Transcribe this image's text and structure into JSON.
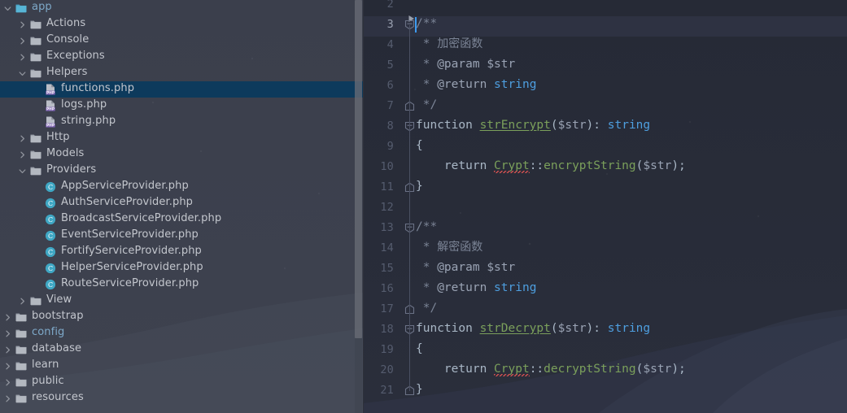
{
  "app": {
    "theme": "dark",
    "accent_selection": "#0d3a5c",
    "sidebar_bg": "#3b3f4c",
    "editor_bg": "#272b38"
  },
  "sidebar": {
    "name": "project-tree",
    "scrollbar": {
      "name": "sidebar-scrollbar"
    },
    "items": [
      {
        "label": "app",
        "depth": 0,
        "arrow": "down",
        "icon": "folder-module-icon",
        "color": "blue",
        "selected": false
      },
      {
        "label": "Actions",
        "depth": 1,
        "arrow": "right",
        "icon": "folder-icon",
        "color": "white",
        "selected": false
      },
      {
        "label": "Console",
        "depth": 1,
        "arrow": "right",
        "icon": "folder-icon",
        "color": "white",
        "selected": false
      },
      {
        "label": "Exceptions",
        "depth": 1,
        "arrow": "right",
        "icon": "folder-icon",
        "color": "white",
        "selected": false
      },
      {
        "label": "Helpers",
        "depth": 1,
        "arrow": "down",
        "icon": "folder-icon",
        "color": "white",
        "selected": false
      },
      {
        "label": "functions.php",
        "depth": 2,
        "arrow": "none",
        "icon": "php-file-icon",
        "color": "white",
        "selected": true
      },
      {
        "label": "logs.php",
        "depth": 2,
        "arrow": "none",
        "icon": "php-file-icon",
        "color": "white",
        "selected": false
      },
      {
        "label": "string.php",
        "depth": 2,
        "arrow": "none",
        "icon": "php-file-icon",
        "color": "white",
        "selected": false
      },
      {
        "label": "Http",
        "depth": 1,
        "arrow": "right",
        "icon": "folder-icon",
        "color": "white",
        "selected": false
      },
      {
        "label": "Models",
        "depth": 1,
        "arrow": "right",
        "icon": "folder-icon",
        "color": "white",
        "selected": false
      },
      {
        "label": "Providers",
        "depth": 1,
        "arrow": "down",
        "icon": "folder-icon",
        "color": "white",
        "selected": false
      },
      {
        "label": "AppServiceProvider.php",
        "depth": 2,
        "arrow": "none",
        "icon": "php-class-icon",
        "color": "white",
        "selected": false
      },
      {
        "label": "AuthServiceProvider.php",
        "depth": 2,
        "arrow": "none",
        "icon": "php-class-icon",
        "color": "white",
        "selected": false
      },
      {
        "label": "BroadcastServiceProvider.php",
        "depth": 2,
        "arrow": "none",
        "icon": "php-class-icon",
        "color": "white",
        "selected": false
      },
      {
        "label": "EventServiceProvider.php",
        "depth": 2,
        "arrow": "none",
        "icon": "php-class-icon",
        "color": "white",
        "selected": false
      },
      {
        "label": "FortifyServiceProvider.php",
        "depth": 2,
        "arrow": "none",
        "icon": "php-class-icon",
        "color": "white",
        "selected": false
      },
      {
        "label": "HelperServiceProvider.php",
        "depth": 2,
        "arrow": "none",
        "icon": "php-class-icon",
        "color": "white",
        "selected": false
      },
      {
        "label": "RouteServiceProvider.php",
        "depth": 2,
        "arrow": "none",
        "icon": "php-class-icon",
        "color": "white",
        "selected": false
      },
      {
        "label": "View",
        "depth": 1,
        "arrow": "right",
        "icon": "folder-icon",
        "color": "white",
        "selected": false
      },
      {
        "label": "bootstrap",
        "depth": 0,
        "arrow": "right",
        "icon": "folder-icon",
        "color": "white",
        "selected": false
      },
      {
        "label": "config",
        "depth": 0,
        "arrow": "right",
        "icon": "folder-icon",
        "color": "blue",
        "selected": false
      },
      {
        "label": "database",
        "depth": 0,
        "arrow": "right",
        "icon": "folder-icon",
        "color": "white",
        "selected": false
      },
      {
        "label": "learn",
        "depth": 0,
        "arrow": "right",
        "icon": "folder-icon",
        "color": "white",
        "selected": false
      },
      {
        "label": "public",
        "depth": 0,
        "arrow": "right",
        "icon": "folder-icon",
        "color": "white",
        "selected": false
      },
      {
        "label": "resources",
        "depth": 0,
        "arrow": "right",
        "icon": "folder-icon",
        "color": "white",
        "selected": false
      }
    ]
  },
  "editor": {
    "name": "code-editor",
    "language": "php",
    "caret": {
      "line": 3,
      "column": 1
    },
    "first_visible_line": 2,
    "lines": [
      {
        "n": 2,
        "indent": 0,
        "tokens": []
      },
      {
        "n": 3,
        "indent": 0,
        "fold": "expanded",
        "caret": true,
        "current": true,
        "run_marker": true,
        "tokens": [
          {
            "t": "/**",
            "c": "doc"
          }
        ]
      },
      {
        "n": 4,
        "indent": 0,
        "tokens": [
          {
            "t": " * ",
            "c": "doc"
          },
          {
            "t": "加密函数",
            "c": "cjk"
          }
        ]
      },
      {
        "n": 5,
        "indent": 0,
        "tokens": [
          {
            "t": " * ",
            "c": "doc"
          },
          {
            "t": "@param ",
            "c": "doctag"
          },
          {
            "t": "$str",
            "c": "doctag"
          }
        ]
      },
      {
        "n": 6,
        "indent": 0,
        "tokens": [
          {
            "t": " * ",
            "c": "doc"
          },
          {
            "t": "@return ",
            "c": "doctag"
          },
          {
            "t": "string",
            "c": "type"
          }
        ]
      },
      {
        "n": 7,
        "indent": 0,
        "fold": "end",
        "tokens": [
          {
            "t": " */",
            "c": "doc"
          }
        ]
      },
      {
        "n": 8,
        "indent": 0,
        "fold": "expanded",
        "tokens": [
          {
            "t": "function ",
            "c": "def"
          },
          {
            "t": "strEncrypt",
            "c": "fn-u"
          },
          {
            "t": "(",
            "c": "punct"
          },
          {
            "t": "$str",
            "c": "var"
          },
          {
            "t": ")",
            "c": "punct"
          },
          {
            "t": ": ",
            "c": "punct"
          },
          {
            "t": "string",
            "c": "type"
          }
        ]
      },
      {
        "n": 9,
        "indent": 0,
        "tokens": [
          {
            "t": "{",
            "c": "def"
          }
        ]
      },
      {
        "n": 10,
        "indent": 0,
        "tokens": [
          {
            "t": "    return ",
            "c": "def"
          },
          {
            "t": "Crypt",
            "c": "err"
          },
          {
            "t": "::",
            "c": "punct"
          },
          {
            "t": "encryptString",
            "c": "fn"
          },
          {
            "t": "(",
            "c": "punct"
          },
          {
            "t": "$str",
            "c": "var"
          },
          {
            "t": ");",
            "c": "punct"
          }
        ]
      },
      {
        "n": 11,
        "indent": 0,
        "fold": "end",
        "tokens": [
          {
            "t": "}",
            "c": "def"
          }
        ]
      },
      {
        "n": 12,
        "indent": 0,
        "tokens": []
      },
      {
        "n": 13,
        "indent": 0,
        "fold": "expanded",
        "tokens": [
          {
            "t": "/**",
            "c": "doc"
          }
        ]
      },
      {
        "n": 14,
        "indent": 0,
        "tokens": [
          {
            "t": " * ",
            "c": "doc"
          },
          {
            "t": "解密函数",
            "c": "cjk"
          }
        ]
      },
      {
        "n": 15,
        "indent": 0,
        "tokens": [
          {
            "t": " * ",
            "c": "doc"
          },
          {
            "t": "@param ",
            "c": "doctag"
          },
          {
            "t": "$str",
            "c": "doctag"
          }
        ]
      },
      {
        "n": 16,
        "indent": 0,
        "tokens": [
          {
            "t": " * ",
            "c": "doc"
          },
          {
            "t": "@return ",
            "c": "doctag"
          },
          {
            "t": "string",
            "c": "type"
          }
        ]
      },
      {
        "n": 17,
        "indent": 0,
        "fold": "end",
        "tokens": [
          {
            "t": " */",
            "c": "doc"
          }
        ]
      },
      {
        "n": 18,
        "indent": 0,
        "fold": "expanded",
        "tokens": [
          {
            "t": "function ",
            "c": "def"
          },
          {
            "t": "strDecrypt",
            "c": "fn-u"
          },
          {
            "t": "(",
            "c": "punct"
          },
          {
            "t": "$str",
            "c": "var"
          },
          {
            "t": ")",
            "c": "punct"
          },
          {
            "t": ": ",
            "c": "punct"
          },
          {
            "t": "string",
            "c": "type"
          }
        ]
      },
      {
        "n": 19,
        "indent": 0,
        "tokens": [
          {
            "t": "{",
            "c": "def"
          }
        ]
      },
      {
        "n": 20,
        "indent": 0,
        "tokens": [
          {
            "t": "    return ",
            "c": "def"
          },
          {
            "t": "Crypt",
            "c": "err"
          },
          {
            "t": "::",
            "c": "punct"
          },
          {
            "t": "decryptString",
            "c": "fn"
          },
          {
            "t": "(",
            "c": "punct"
          },
          {
            "t": "$str",
            "c": "var"
          },
          {
            "t": ");",
            "c": "punct"
          }
        ]
      },
      {
        "n": 21,
        "indent": 0,
        "fold": "end",
        "tokens": [
          {
            "t": "}",
            "c": "def"
          }
        ]
      }
    ],
    "partial_top_line": {
      "text": "{}",
      "color": "#c8c044"
    },
    "colors": {
      "keyword": "#a9b7c6",
      "function_name": "#7ba05b",
      "variable": "#9aa3b4",
      "type": "#4e9fe0",
      "doc_comment": "#7b8496",
      "error_underline": "#d05050",
      "caret": "#3d9bf0",
      "current_line": "#2e3242"
    }
  }
}
